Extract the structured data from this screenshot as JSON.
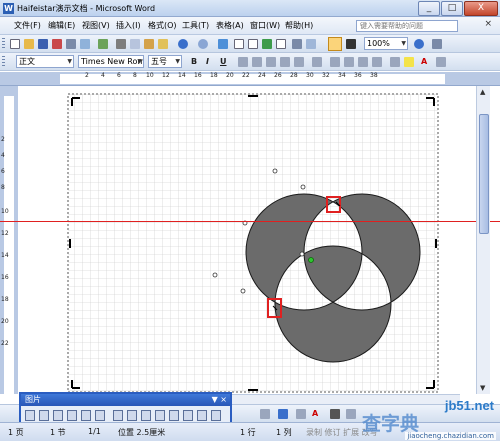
{
  "window": {
    "title": "Haifeistar演示文档 - Microsoft Word",
    "minimize": "_",
    "maximize": "□",
    "close": "X"
  },
  "menu": {
    "items": [
      "文件(F)",
      "编辑(E)",
      "视图(V)",
      "插入(I)",
      "格式(O)",
      "工具(T)",
      "表格(A)",
      "窗口(W)",
      "帮助(H)"
    ],
    "help_placeholder": "键入需要帮助的问题",
    "doc_close": "×"
  },
  "standard_toolbar": {
    "zoom": "100%",
    "icons": [
      "new-icon",
      "open-icon",
      "save-icon",
      "permission-icon",
      "print-icon",
      "preview-icon",
      "spelling-icon",
      "cut-icon",
      "copy-icon",
      "paste-icon",
      "format-painter-icon",
      "undo-icon",
      "redo-icon",
      "hyperlink-icon",
      "tables-icon",
      "insert-table-icon",
      "excel-icon",
      "columns-icon",
      "drawing-icon",
      "document-map-icon",
      "show-hide-icon",
      "help-icon",
      "read-icon"
    ]
  },
  "formatting_toolbar": {
    "style": "正文",
    "font": "Times New Roman",
    "size": "五号",
    "bold": "B",
    "italic": "I",
    "underline": "U",
    "font_color_glyph": "A"
  },
  "ruler": {
    "h_numbers": [
      "2",
      "4",
      "6",
      "8",
      "10",
      "12",
      "14",
      "16",
      "18",
      "20",
      "22",
      "24",
      "26",
      "28",
      "30",
      "32",
      "34",
      "36",
      "38"
    ],
    "v_numbers": [
      "2",
      "4",
      "6",
      "8",
      "10",
      "12",
      "14",
      "16",
      "18",
      "20",
      "22"
    ]
  },
  "picture_toolbar": {
    "title": "图片",
    "controls": "▼ ×"
  },
  "status": {
    "page": "1 页",
    "section": "1 节",
    "pages": "1/1",
    "position": "位置 2.5厘米",
    "line": "1 行",
    "column": "1 列",
    "modes": "录制 修订 扩展 改写"
  },
  "watermark": {
    "site": "jb51.net",
    "big": "查字典",
    "url": "jiaocheng.chazidian.com"
  },
  "colors": {
    "accent": "#2a5dc1",
    "circle_fill": "#6b6b6b",
    "guide_line": "#e02020",
    "handle_box": "#e02020"
  }
}
